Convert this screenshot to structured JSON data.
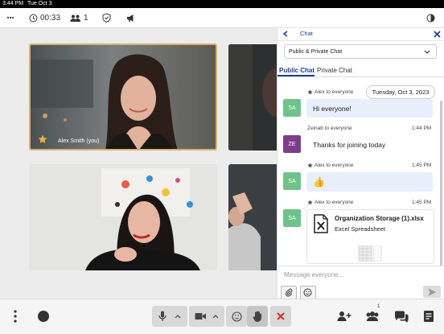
{
  "status_bar": {
    "time": "3:44 PM",
    "date": "Tue Oct 3"
  },
  "top_bar": {
    "timer": "00:33",
    "participant_count": "1"
  },
  "participants": [
    {
      "name": "Alex Smith (you)"
    }
  ],
  "chat": {
    "title": "Chat",
    "audience_select": "Public & Private Chat",
    "tabs": [
      "Public Chat",
      "Private Chat"
    ],
    "date_pill": "Tuesday, Oct 3, 2023",
    "messages": [
      {
        "from": "Alex to everyone",
        "time": "",
        "avatar": "SA",
        "text": "Hi everyone!"
      },
      {
        "from": "Zeinab to everyone",
        "time": "1:44 PM",
        "avatar": "ZE",
        "text": "Thanks for joining today"
      },
      {
        "from": "Alex to everyone",
        "time": "1:45 PM",
        "avatar": "SA",
        "text": "👍"
      },
      {
        "from": "Alex to everyone",
        "time": "1:45 PM",
        "avatar": "SA",
        "file_name": "Organization Storage (1).xlsx",
        "file_type": "Excel Spreadsheet"
      }
    ],
    "input_placeholder": "Message everyone..."
  },
  "bottom_bar": {
    "participants_badge": "1"
  },
  "colors": {
    "accent": "#1c3f8f",
    "end": "#d0312d",
    "avatar_sa": "#6fc38a",
    "avatar_ze": "#7b3f8c",
    "highlight_border": "#d9b26a"
  }
}
